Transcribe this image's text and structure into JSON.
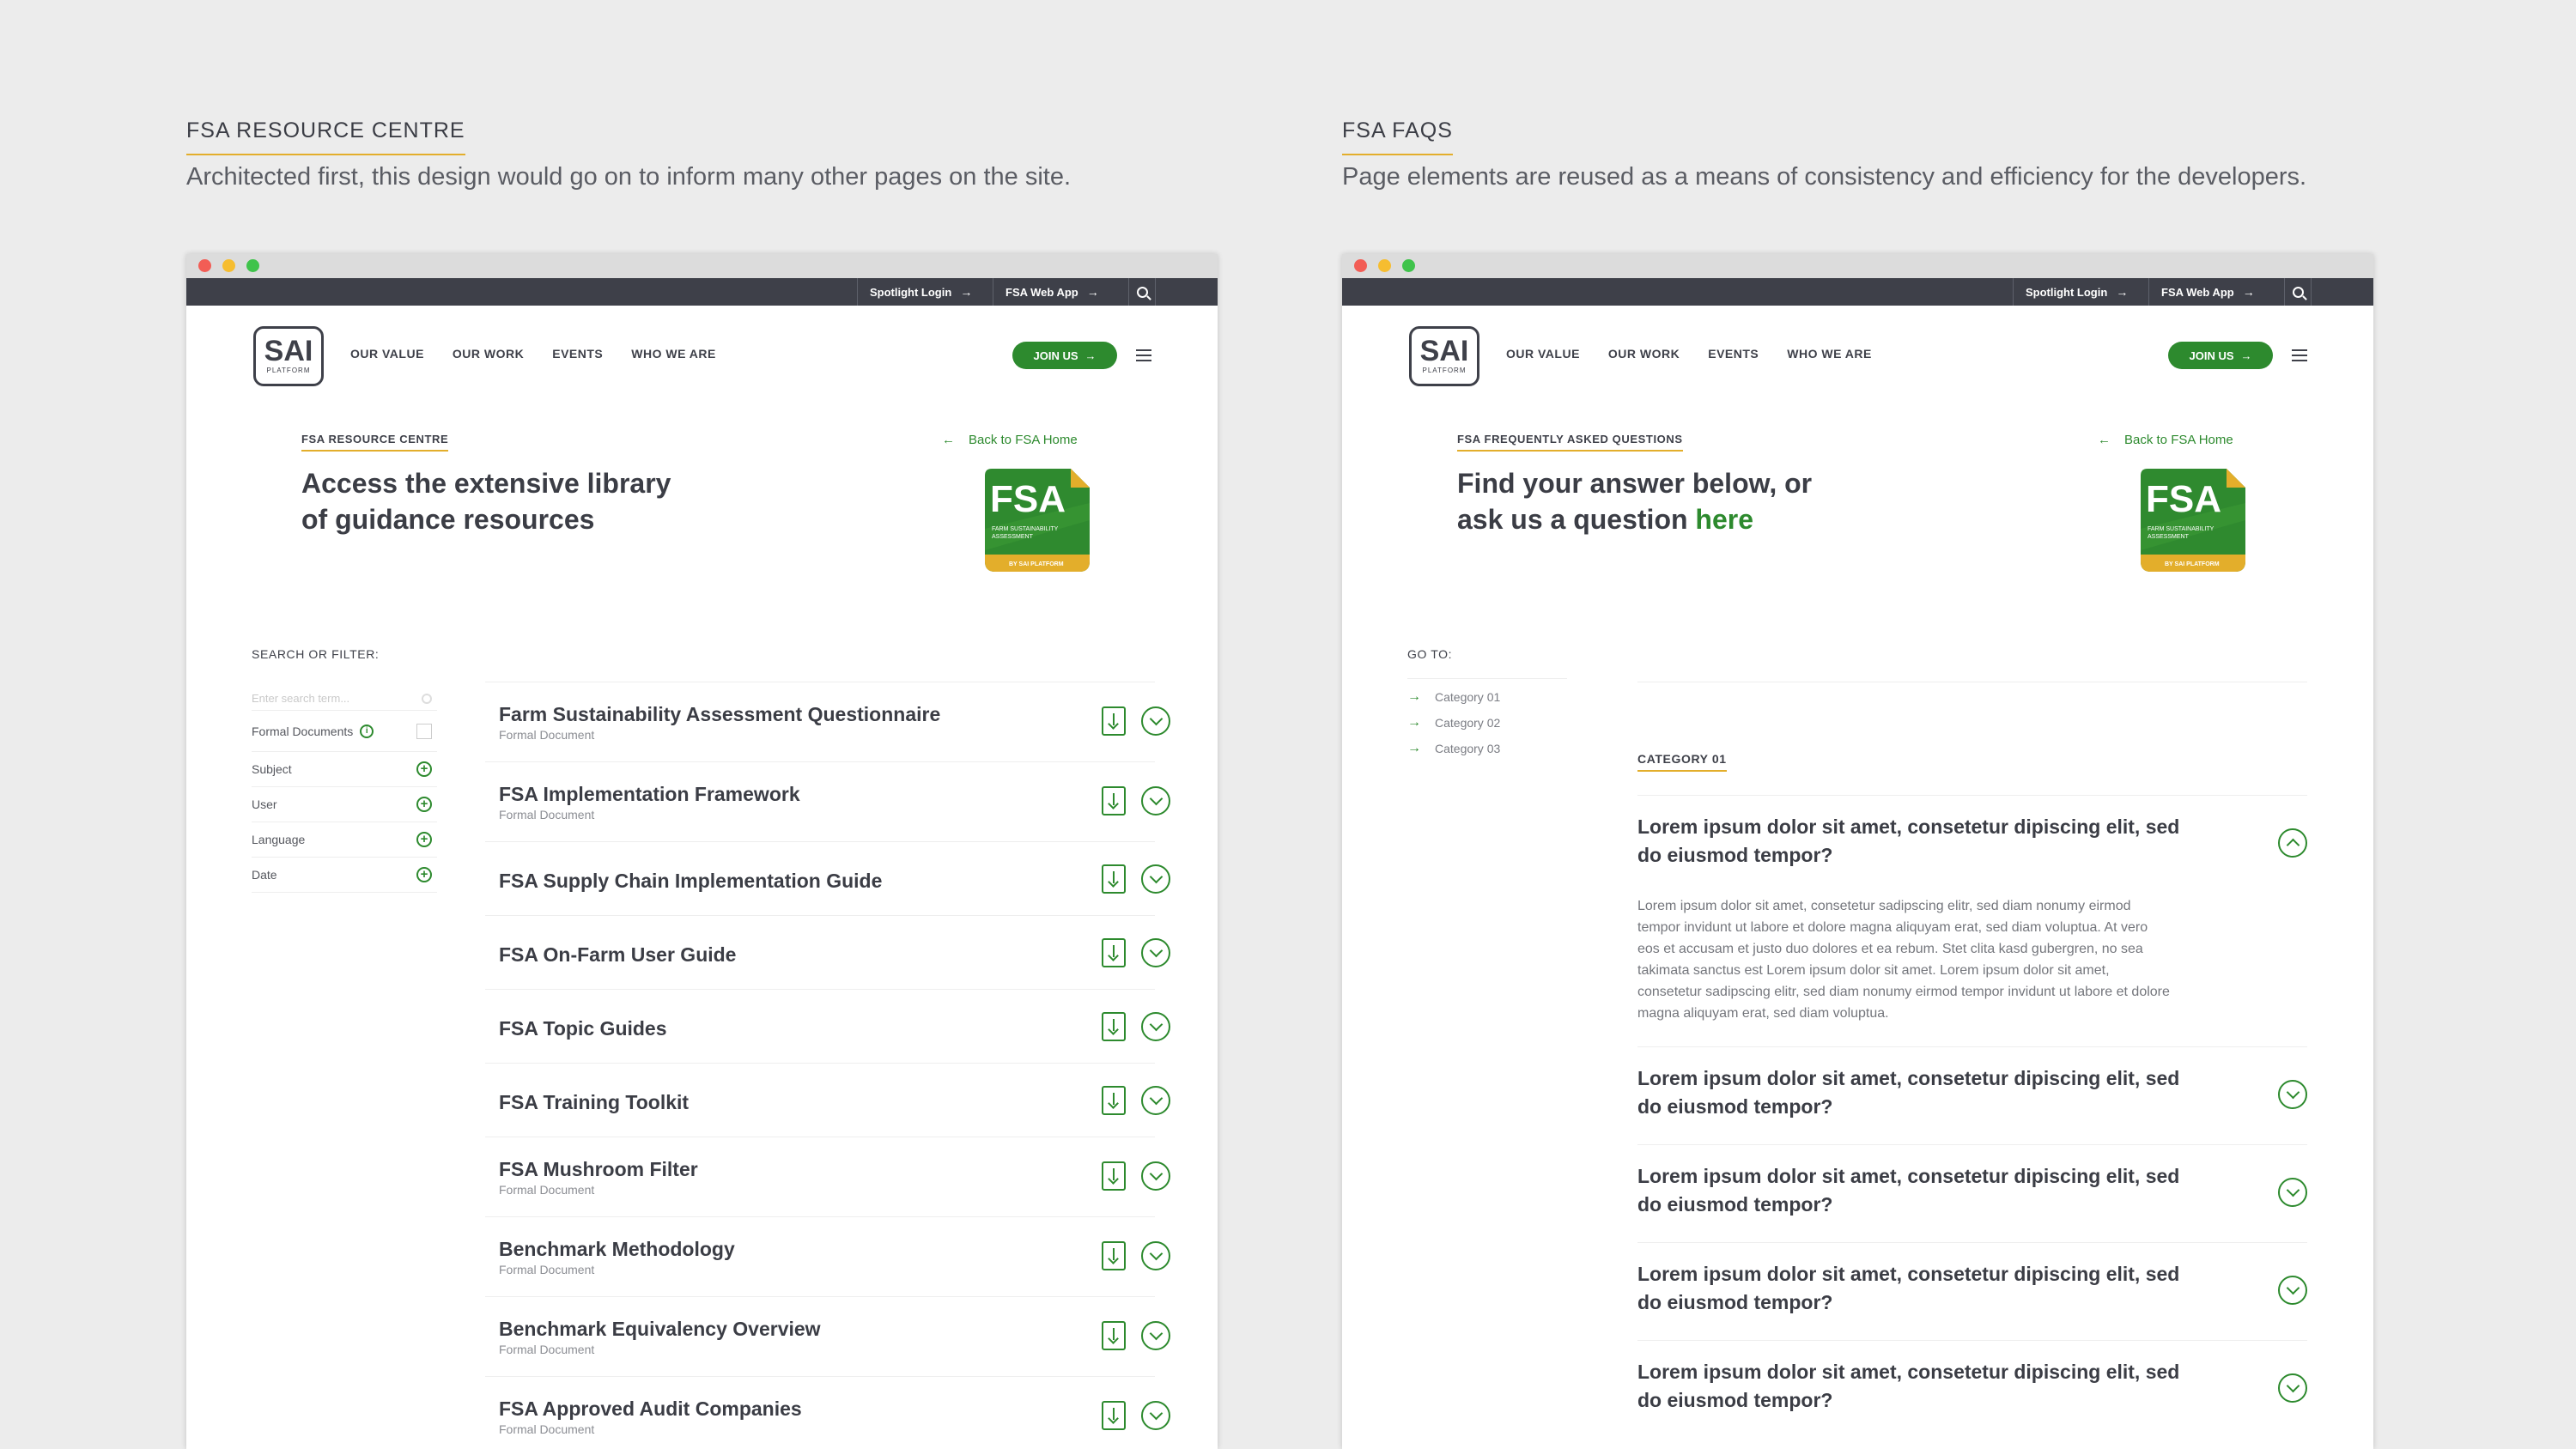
{
  "left": {
    "section_title": "FSA RESOURCE CENTRE",
    "section_desc": "Architected first, this design would go on to inform many other pages on the site.",
    "topbar": {
      "spotlight": "Spotlight Login",
      "webapp": "FSA Web App"
    },
    "nav": {
      "logo_big": "SAI",
      "logo_small": "PLATFORM",
      "links": [
        "OUR VALUE",
        "OUR WORK",
        "EVENTS",
        "WHO WE ARE"
      ],
      "join": "JOIN US"
    },
    "hero": {
      "eyebrow": "FSA RESOURCE CENTRE",
      "line1": "Access the extensive library",
      "line2": "of guidance resources",
      "back": "Back to FSA Home"
    },
    "badge": {
      "big": "FSA",
      "l1": "FARM SUSTAINABILITY",
      "l2": "ASSESSMENT",
      "foot": "BY SAI PLATFORM"
    },
    "filter": {
      "label": "SEARCH OR FILTER:",
      "placeholder": "Enter search term...",
      "formal": "Formal Documents",
      "items": [
        "Subject",
        "User",
        "Language",
        "Date"
      ]
    },
    "docs": [
      {
        "title": "Farm Sustainability Assessment Questionnaire",
        "sub": "Formal Document"
      },
      {
        "title": "FSA Implementation Framework",
        "sub": "Formal Document"
      },
      {
        "title": "FSA Supply Chain Implementation Guide",
        "sub": ""
      },
      {
        "title": "FSA On-Farm User Guide",
        "sub": ""
      },
      {
        "title": "FSA Topic Guides",
        "sub": ""
      },
      {
        "title": "FSA Training Toolkit",
        "sub": ""
      },
      {
        "title": "FSA Mushroom Filter",
        "sub": "Formal Document"
      },
      {
        "title": "Benchmark Methodology",
        "sub": "Formal Document"
      },
      {
        "title": "Benchmark Equivalency Overview",
        "sub": "Formal Document"
      },
      {
        "title": "FSA Approved Audit Companies",
        "sub": "Formal Document"
      }
    ]
  },
  "right": {
    "section_title": "FSA FAQS",
    "section_desc": "Page elements are reused as a means of consistency and efficiency for the developers.",
    "topbar": {
      "spotlight": "Spotlight Login",
      "webapp": "FSA Web App"
    },
    "nav": {
      "logo_big": "SAI",
      "logo_small": "PLATFORM",
      "links": [
        "OUR VALUE",
        "OUR WORK",
        "EVENTS",
        "WHO WE ARE"
      ],
      "join": "JOIN US"
    },
    "hero": {
      "eyebrow": "FSA FREQUENTLY ASKED QUESTIONS",
      "line1": "Find your answer below, or",
      "line2_pre": "ask us a question ",
      "line2_link": "here",
      "back": "Back to FSA Home"
    },
    "badge": {
      "big": "FSA",
      "l1": "FARM SUSTAINABILITY",
      "l2": "ASSESSMENT",
      "foot": "BY SAI PLATFORM"
    },
    "goto": {
      "label": "GO TO:",
      "items": [
        "Category 01",
        "Category 02",
        "Category 03"
      ]
    },
    "category": "CATEGORY 01",
    "faqs": [
      {
        "q": "Lorem ipsum dolor sit amet, consetetur dipiscing elit, sed do eiusmod tempor?",
        "a": "Lorem ipsum dolor sit amet, consetetur sadipscing elitr, sed diam nonumy eirmod tempor invidunt ut labore et dolore magna aliquyam erat, sed diam voluptua. At vero eos et accusam et justo duo dolores et ea rebum. Stet clita kasd gubergren, no sea takimata sanctus est Lorem ipsum dolor sit amet. Lorem ipsum dolor sit amet, consetetur sadipscing elitr, sed diam nonumy eirmod tempor invidunt ut labore et dolore magna aliquyam erat, sed diam voluptua."
      },
      {
        "q": "Lorem ipsum dolor sit amet, consetetur dipiscing elit, sed do eiusmod tempor?"
      },
      {
        "q": "Lorem ipsum dolor sit amet, consetetur dipiscing elit, sed do eiusmod tempor?"
      },
      {
        "q": "Lorem ipsum dolor sit amet, consetetur dipiscing elit, sed do eiusmod tempor?"
      },
      {
        "q": "Lorem ipsum dolor sit amet, consetetur dipiscing elit, sed do eiusmod tempor?"
      }
    ]
  },
  "colors": {
    "green": "#2d8a2e",
    "gold": "#e3ae2b",
    "dark": "#3e4049"
  }
}
